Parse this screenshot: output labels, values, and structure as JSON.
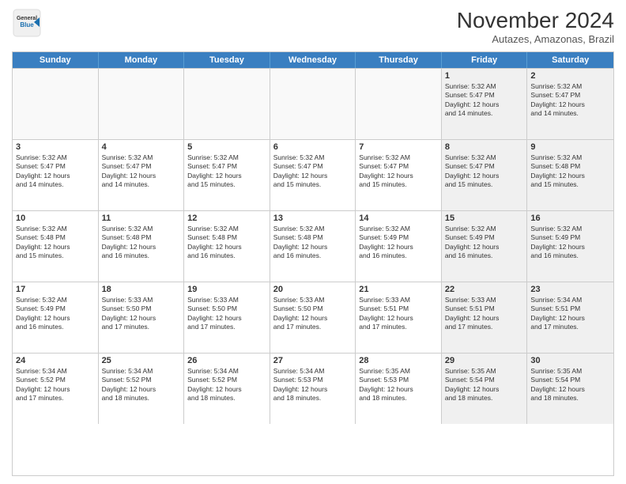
{
  "logo": {
    "line1": "General",
    "line2": "Blue"
  },
  "title": "November 2024",
  "location": "Autazes, Amazonas, Brazil",
  "days_of_week": [
    "Sunday",
    "Monday",
    "Tuesday",
    "Wednesday",
    "Thursday",
    "Friday",
    "Saturday"
  ],
  "weeks": [
    [
      {
        "day": "",
        "info": ""
      },
      {
        "day": "",
        "info": ""
      },
      {
        "day": "",
        "info": ""
      },
      {
        "day": "",
        "info": ""
      },
      {
        "day": "",
        "info": ""
      },
      {
        "day": "1",
        "info": "Sunrise: 5:32 AM\nSunset: 5:47 PM\nDaylight: 12 hours\nand 14 minutes."
      },
      {
        "day": "2",
        "info": "Sunrise: 5:32 AM\nSunset: 5:47 PM\nDaylight: 12 hours\nand 14 minutes."
      }
    ],
    [
      {
        "day": "3",
        "info": "Sunrise: 5:32 AM\nSunset: 5:47 PM\nDaylight: 12 hours\nand 14 minutes."
      },
      {
        "day": "4",
        "info": "Sunrise: 5:32 AM\nSunset: 5:47 PM\nDaylight: 12 hours\nand 14 minutes."
      },
      {
        "day": "5",
        "info": "Sunrise: 5:32 AM\nSunset: 5:47 PM\nDaylight: 12 hours\nand 15 minutes."
      },
      {
        "day": "6",
        "info": "Sunrise: 5:32 AM\nSunset: 5:47 PM\nDaylight: 12 hours\nand 15 minutes."
      },
      {
        "day": "7",
        "info": "Sunrise: 5:32 AM\nSunset: 5:47 PM\nDaylight: 12 hours\nand 15 minutes."
      },
      {
        "day": "8",
        "info": "Sunrise: 5:32 AM\nSunset: 5:47 PM\nDaylight: 12 hours\nand 15 minutes."
      },
      {
        "day": "9",
        "info": "Sunrise: 5:32 AM\nSunset: 5:48 PM\nDaylight: 12 hours\nand 15 minutes."
      }
    ],
    [
      {
        "day": "10",
        "info": "Sunrise: 5:32 AM\nSunset: 5:48 PM\nDaylight: 12 hours\nand 15 minutes."
      },
      {
        "day": "11",
        "info": "Sunrise: 5:32 AM\nSunset: 5:48 PM\nDaylight: 12 hours\nand 16 minutes."
      },
      {
        "day": "12",
        "info": "Sunrise: 5:32 AM\nSunset: 5:48 PM\nDaylight: 12 hours\nand 16 minutes."
      },
      {
        "day": "13",
        "info": "Sunrise: 5:32 AM\nSunset: 5:48 PM\nDaylight: 12 hours\nand 16 minutes."
      },
      {
        "day": "14",
        "info": "Sunrise: 5:32 AM\nSunset: 5:49 PM\nDaylight: 12 hours\nand 16 minutes."
      },
      {
        "day": "15",
        "info": "Sunrise: 5:32 AM\nSunset: 5:49 PM\nDaylight: 12 hours\nand 16 minutes."
      },
      {
        "day": "16",
        "info": "Sunrise: 5:32 AM\nSunset: 5:49 PM\nDaylight: 12 hours\nand 16 minutes."
      }
    ],
    [
      {
        "day": "17",
        "info": "Sunrise: 5:32 AM\nSunset: 5:49 PM\nDaylight: 12 hours\nand 16 minutes."
      },
      {
        "day": "18",
        "info": "Sunrise: 5:33 AM\nSunset: 5:50 PM\nDaylight: 12 hours\nand 17 minutes."
      },
      {
        "day": "19",
        "info": "Sunrise: 5:33 AM\nSunset: 5:50 PM\nDaylight: 12 hours\nand 17 minutes."
      },
      {
        "day": "20",
        "info": "Sunrise: 5:33 AM\nSunset: 5:50 PM\nDaylight: 12 hours\nand 17 minutes."
      },
      {
        "day": "21",
        "info": "Sunrise: 5:33 AM\nSunset: 5:51 PM\nDaylight: 12 hours\nand 17 minutes."
      },
      {
        "day": "22",
        "info": "Sunrise: 5:33 AM\nSunset: 5:51 PM\nDaylight: 12 hours\nand 17 minutes."
      },
      {
        "day": "23",
        "info": "Sunrise: 5:34 AM\nSunset: 5:51 PM\nDaylight: 12 hours\nand 17 minutes."
      }
    ],
    [
      {
        "day": "24",
        "info": "Sunrise: 5:34 AM\nSunset: 5:52 PM\nDaylight: 12 hours\nand 17 minutes."
      },
      {
        "day": "25",
        "info": "Sunrise: 5:34 AM\nSunset: 5:52 PM\nDaylight: 12 hours\nand 18 minutes."
      },
      {
        "day": "26",
        "info": "Sunrise: 5:34 AM\nSunset: 5:52 PM\nDaylight: 12 hours\nand 18 minutes."
      },
      {
        "day": "27",
        "info": "Sunrise: 5:34 AM\nSunset: 5:53 PM\nDaylight: 12 hours\nand 18 minutes."
      },
      {
        "day": "28",
        "info": "Sunrise: 5:35 AM\nSunset: 5:53 PM\nDaylight: 12 hours\nand 18 minutes."
      },
      {
        "day": "29",
        "info": "Sunrise: 5:35 AM\nSunset: 5:54 PM\nDaylight: 12 hours\nand 18 minutes."
      },
      {
        "day": "30",
        "info": "Sunrise: 5:35 AM\nSunset: 5:54 PM\nDaylight: 12 hours\nand 18 minutes."
      }
    ]
  ]
}
